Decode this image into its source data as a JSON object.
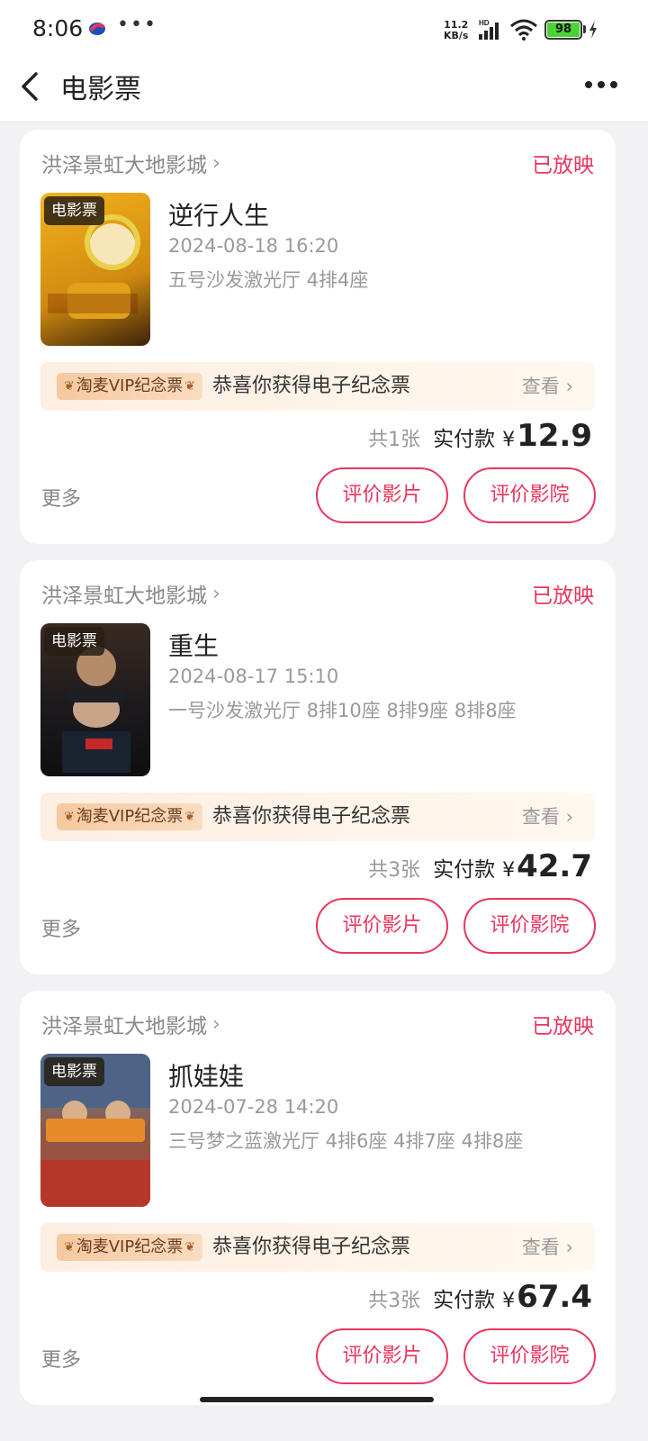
{
  "status_bar": {
    "time": "8:06",
    "dots": "•••",
    "speed_top": "11.2",
    "speed_bottom": "KB/s",
    "hd": "HD",
    "battery": "98"
  },
  "nav": {
    "title": "电影票"
  },
  "orders": [
    {
      "cinema": "洪泽景虹大地影城",
      "status": "已放映",
      "poster_tag": "电影票",
      "title": "逆行人生",
      "datetime": "2024-08-18 16:20",
      "seats": "五号沙发激光厅 4排4座",
      "vip_badge": "淘麦VIP纪念票",
      "vip_text": "恭喜你获得电子纪念票",
      "vip_view": "查看",
      "count": "共1张",
      "pay_label": "实付款",
      "currency": "¥",
      "amount": "12.9",
      "more": "更多",
      "btn_film": "评价影片",
      "btn_cinema": "评价影院",
      "poster_colors": [
        "#f2b21d",
        "#d18a10"
      ]
    },
    {
      "cinema": "洪泽景虹大地影城",
      "status": "已放映",
      "poster_tag": "电影票",
      "title": "重生",
      "datetime": "2024-08-17 15:10",
      "seats": "一号沙发激光厅 8排10座 8排9座 8排8座",
      "vip_badge": "淘麦VIP纪念票",
      "vip_text": "恭喜你获得电子纪念票",
      "vip_view": "查看",
      "count": "共3张",
      "pay_label": "实付款",
      "currency": "¥",
      "amount": "42.7",
      "more": "更多",
      "btn_film": "评价影片",
      "btn_cinema": "评价影院",
      "poster_colors": [
        "#3a2a22",
        "#121418"
      ]
    },
    {
      "cinema": "洪泽景虹大地影城",
      "status": "已放映",
      "poster_tag": "电影票",
      "title": "抓娃娃",
      "datetime": "2024-07-28 14:20",
      "seats": "三号梦之蓝激光厅 4排6座 4排7座 4排8座",
      "vip_badge": "淘麦VIP纪念票",
      "vip_text": "恭喜你获得电子纪念票",
      "vip_view": "查看",
      "count": "共3张",
      "pay_label": "实付款",
      "currency": "¥",
      "amount": "67.4",
      "more": "更多",
      "btn_film": "评价影片",
      "btn_cinema": "评价影院",
      "poster_colors": [
        "#5a6f94",
        "#b7412a"
      ]
    }
  ]
}
